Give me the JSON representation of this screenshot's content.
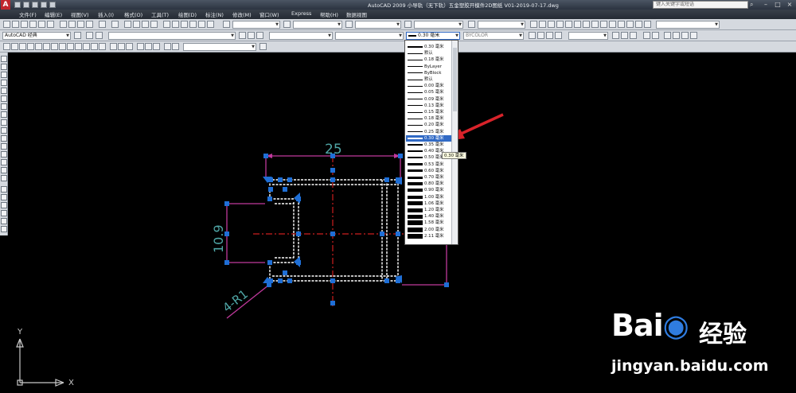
{
  "window": {
    "title": "AutoCAD 2009  小导轨（无下轨）五金塑胶开模件2D图纸 V01-2019-07-17.dwg",
    "search_placeholder": "键入关键字或短语"
  },
  "menu": [
    "文件(F)",
    "编辑(E)",
    "视图(V)",
    "插入(I)",
    "格式(O)",
    "工具(T)",
    "绘图(D)",
    "标注(N)",
    "修改(M)",
    "窗口(W)",
    "Express",
    "帮助(H)",
    "数据视图"
  ],
  "toolbar": {
    "workspace": "AutoCAD 经典",
    "lineweight_value": "0.30 毫米",
    "plot_style": "BYCOLOR"
  },
  "lineweight_list": {
    "items": [
      {
        "label": "0.30 毫米",
        "w": 2
      },
      {
        "label": "默认",
        "w": 1
      },
      {
        "label": "0.18 毫米",
        "w": 1
      },
      {
        "label": "ByLayer",
        "w": 1
      },
      {
        "label": "ByBlock",
        "w": 1
      },
      {
        "label": "默认",
        "w": 1
      },
      {
        "label": "0.00 毫米",
        "w": 1
      },
      {
        "label": "0.05 毫米",
        "w": 1
      },
      {
        "label": "0.09 毫米",
        "w": 1
      },
      {
        "label": "0.13 毫米",
        "w": 1
      },
      {
        "label": "0.15 毫米",
        "w": 1
      },
      {
        "label": "0.18 毫米",
        "w": 1
      },
      {
        "label": "0.20 毫米",
        "w": 1
      },
      {
        "label": "0.25 毫米",
        "w": 1
      },
      {
        "label": "0.30 毫米",
        "w": 2,
        "selected": true
      },
      {
        "label": "0.35 毫米",
        "w": 2
      },
      {
        "label": "0.40 毫米",
        "w": 2
      },
      {
        "label": "0.50 毫米",
        "w": 2
      },
      {
        "label": "0.53 毫米",
        "w": 3
      },
      {
        "label": "0.60 毫米",
        "w": 3
      },
      {
        "label": "0.70 毫米",
        "w": 3
      },
      {
        "label": "0.80 毫米",
        "w": 4
      },
      {
        "label": "0.90 毫米",
        "w": 4
      },
      {
        "label": "1.00 毫米",
        "w": 4
      },
      {
        "label": "1.06 毫米",
        "w": 5
      },
      {
        "label": "1.20 毫米",
        "w": 5
      },
      {
        "label": "1.40 毫米",
        "w": 5
      },
      {
        "label": "1.58 毫米",
        "w": 6
      },
      {
        "label": "2.00 毫米",
        "w": 6
      },
      {
        "label": "2.11 毫米",
        "w": 6
      }
    ],
    "tooltip": "0.30 毫米"
  },
  "drawing": {
    "dim_width": "25",
    "dim_height": "10.9",
    "dim_radius": "4-R1",
    "axis_x": "X",
    "axis_y": "Y"
  },
  "watermark": {
    "logo": "Bai",
    "logo_suffix": "经验",
    "url": "jingyan.baidu.com"
  },
  "colors": {
    "grip": "#1f6fd6",
    "dimension": "#c0399c",
    "centerline": "#cc1f1f",
    "selection_arrow": "#d8232a"
  }
}
